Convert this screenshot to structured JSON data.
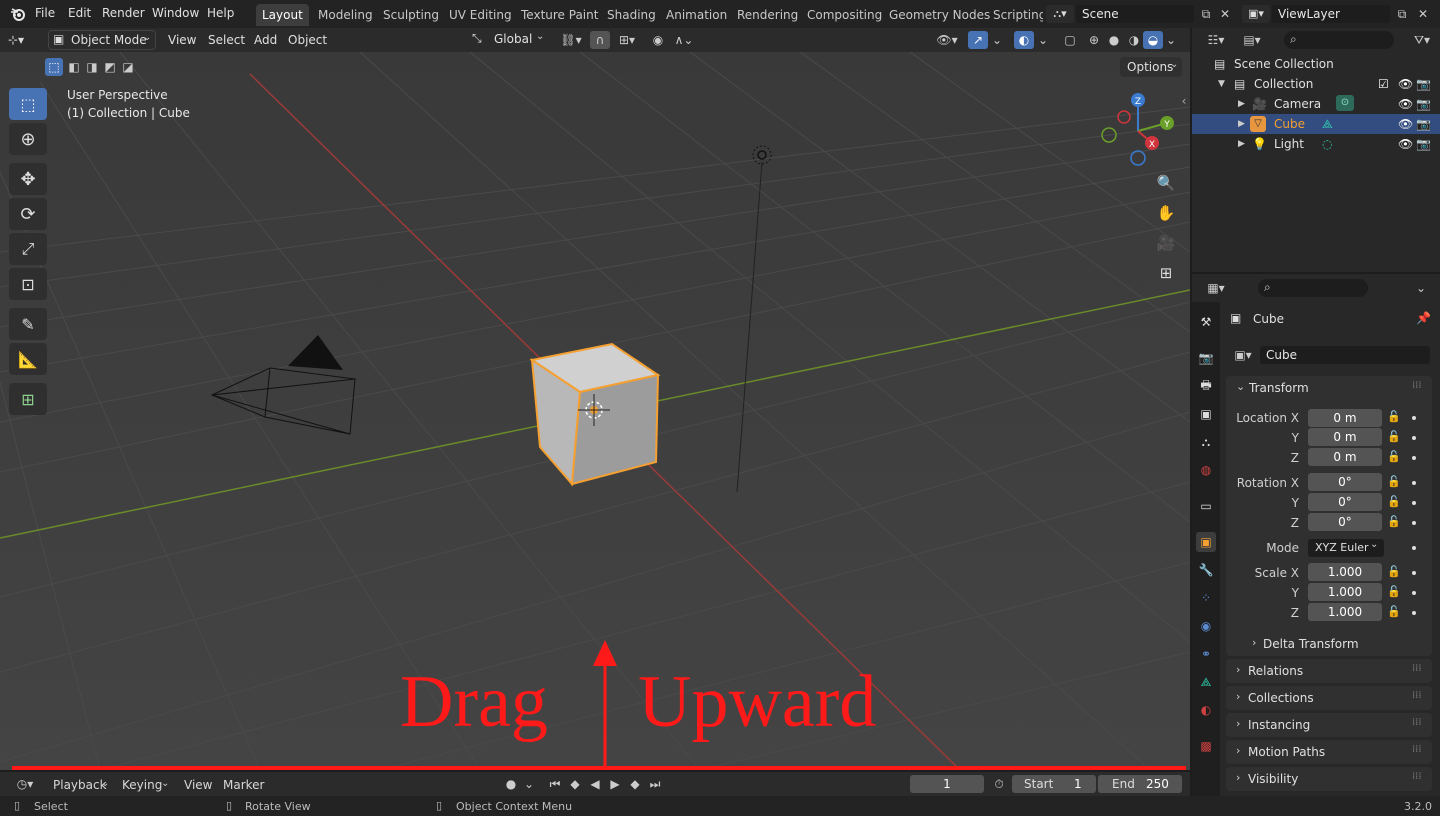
{
  "menu": [
    "File",
    "Edit",
    "Render",
    "Window",
    "Help"
  ],
  "workspaces": [
    "Layout",
    "Modeling",
    "Sculpting",
    "UV Editing",
    "Texture Paint",
    "Shading",
    "Animation",
    "Rendering",
    "Compositing",
    "Geometry Nodes",
    "Scripting"
  ],
  "scene": {
    "name": "Scene"
  },
  "view_layer": {
    "name": "ViewLayer"
  },
  "viewport_header": {
    "mode": "Object Mode",
    "menus": [
      "View",
      "Select",
      "Add",
      "Object"
    ],
    "transform_orientation": "Global",
    "options_label": "Options"
  },
  "viewport": {
    "perspective_label": "User Perspective",
    "collection_label": "(1) Collection | Cube",
    "gizmo_axes": {
      "x": "X",
      "y": "Y",
      "z": "Z"
    },
    "annotation_left": "Drag",
    "annotation_right": "Upward",
    "annotation_color": "#ff1a1a",
    "selection_color": "#f5a030"
  },
  "timeline": {
    "menus": [
      "Playback",
      "Keying",
      "View",
      "Marker"
    ],
    "current_frame": "1",
    "start_label": "Start",
    "start_value": "1",
    "end_label": "End",
    "end_value": "250"
  },
  "status": {
    "left": "Select",
    "middle": "Rotate View",
    "right": "Object Context Menu",
    "version": "3.2.0"
  },
  "outliner": {
    "root": "Scene Collection",
    "collection": "Collection",
    "items": [
      {
        "name": "Camera",
        "selected": false
      },
      {
        "name": "Cube",
        "selected": true
      },
      {
        "name": "Light",
        "selected": false
      }
    ]
  },
  "properties": {
    "object_name": "Cube",
    "data_name": "Cube",
    "transform_title": "Transform",
    "location_label": "Location X",
    "rotation_label": "Rotation X",
    "scale_label": "Scale X",
    "y_label": "Y",
    "z_label": "Z",
    "location": [
      "0 m",
      "0 m",
      "0 m"
    ],
    "rotation": [
      "0°",
      "0°",
      "0°"
    ],
    "mode_label": "Mode",
    "mode_value": "XYZ Euler",
    "scale": [
      "1.000",
      "1.000",
      "1.000"
    ],
    "delta_title": "Delta Transform",
    "panels": [
      "Relations",
      "Collections",
      "Instancing",
      "Motion Paths",
      "Visibility"
    ]
  }
}
